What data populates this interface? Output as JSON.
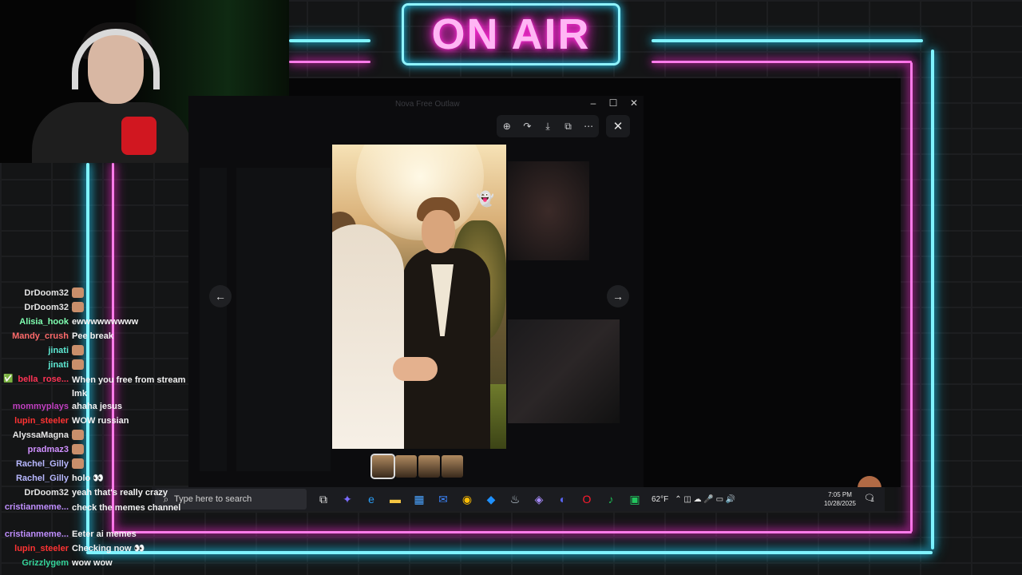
{
  "overlay": {
    "sign_text": "ON AIR",
    "colors": {
      "neon_cyan": "#7ff3ff",
      "neon_pink": "#ff7bea",
      "bar_blue": "#0000d8"
    }
  },
  "window": {
    "title": "Nova Free Outlaw",
    "controls": [
      "–",
      "☐",
      "✕"
    ]
  },
  "viewer": {
    "tools": [
      "zoom-in-icon",
      "forward-icon",
      "download-icon",
      "open-external-icon",
      "more-icon"
    ],
    "tool_glyphs": [
      "⊕",
      "↷",
      "⤓",
      "⧉",
      "⋯"
    ],
    "close_glyph": "✕",
    "prev_glyph": "←",
    "next_glyph": "→",
    "thumbnail_count": 4,
    "selected_thumbnail": 1
  },
  "taskbar": {
    "search_placeholder": "Type here to search",
    "search_icon": "search-icon",
    "apps": [
      {
        "name": "task-view-icon",
        "color": "#e5e5e5",
        "glyph": "⧉"
      },
      {
        "name": "copilot-icon",
        "color": "#7b6cff",
        "glyph": "✦"
      },
      {
        "name": "edge-icon",
        "color": "#2a9df4",
        "glyph": "e"
      },
      {
        "name": "file-explorer-icon",
        "color": "#f5c542",
        "glyph": "▬"
      },
      {
        "name": "store-icon",
        "color": "#4aa3ff",
        "glyph": "▦"
      },
      {
        "name": "mail-icon",
        "color": "#3b82f6",
        "glyph": "✉"
      },
      {
        "name": "chrome-icon",
        "color": "#fbbc05",
        "glyph": "◉"
      },
      {
        "name": "app-blue-icon",
        "color": "#1e90ff",
        "glyph": "◆"
      },
      {
        "name": "steam-icon",
        "color": "#c7d5e0",
        "glyph": "♨"
      },
      {
        "name": "copilot-m365-icon",
        "color": "#a78bfa",
        "glyph": "◈"
      },
      {
        "name": "discord-icon",
        "color": "#5865f2",
        "glyph": "◐"
      },
      {
        "name": "opera-icon",
        "color": "#ff1b2d",
        "glyph": "O"
      },
      {
        "name": "spotify-icon",
        "color": "#1db954",
        "glyph": "♪"
      },
      {
        "name": "app-green-icon",
        "color": "#22c55e",
        "glyph": "▣"
      }
    ],
    "weather": "62°F",
    "time": "7:05 PM",
    "date": "10/28/2025",
    "notification_count": "1"
  },
  "chat": {
    "messages": [
      {
        "user": "DrDoom32",
        "color": "#e5e5e5",
        "text": "",
        "emote": true
      },
      {
        "user": "DrDoom32",
        "color": "#e5e5e5",
        "text": "",
        "emote": true
      },
      {
        "user": "Alisia_hook",
        "color": "#7fffb0",
        "text": "ewwwwwwwww",
        "emote": false
      },
      {
        "user": "Mandy_crush",
        "color": "#ff6b6b",
        "text": "Pee break",
        "emote": false
      },
      {
        "user": "jinati",
        "color": "#5eead4",
        "text": "",
        "emote": true
      },
      {
        "user": "jinati",
        "color": "#5eead4",
        "text": "",
        "emote": true
      },
      {
        "user": "bella_rose...",
        "color": "#ff3355",
        "text": "When you free from stream lmk",
        "emote": false,
        "wrap": true,
        "badge": true
      },
      {
        "user": "mommyplays",
        "color": "#c040c0",
        "text": "ahaha jesus",
        "emote": false
      },
      {
        "user": "lupin_steeler",
        "color": "#ff3333",
        "text": "WOW russian",
        "emote": false
      },
      {
        "user": "AlyssaMagna",
        "color": "#e5e5e5",
        "text": "",
        "emote": true
      },
      {
        "user": "pradmaz3",
        "color": "#d090ff",
        "text": "",
        "emote": true
      },
      {
        "user": "Rachel_Gilly",
        "color": "#b8b8ff",
        "text": "",
        "emote": true
      },
      {
        "user": "Rachel_Gilly",
        "color": "#b8b8ff",
        "text": "holo 👀",
        "emote": false
      },
      {
        "user": "DrDoom32",
        "color": "#e5e5e5",
        "text": "yeah that's really crazy",
        "emote": false
      },
      {
        "user": "cristianmeme...",
        "color": "#c08fff",
        "text": "check the memes channel",
        "emote": false,
        "wrap": true
      },
      {
        "user": "cristianmeme...",
        "color": "#c08fff",
        "text": "Eeter ai memes",
        "emote": false
      },
      {
        "user": "lupin_steeler",
        "color": "#ff3333",
        "text": "Checking now 👀",
        "emote": false
      },
      {
        "user": "Grizzlygem",
        "color": "#34d399",
        "text": "wow wow",
        "emote": false
      }
    ]
  }
}
